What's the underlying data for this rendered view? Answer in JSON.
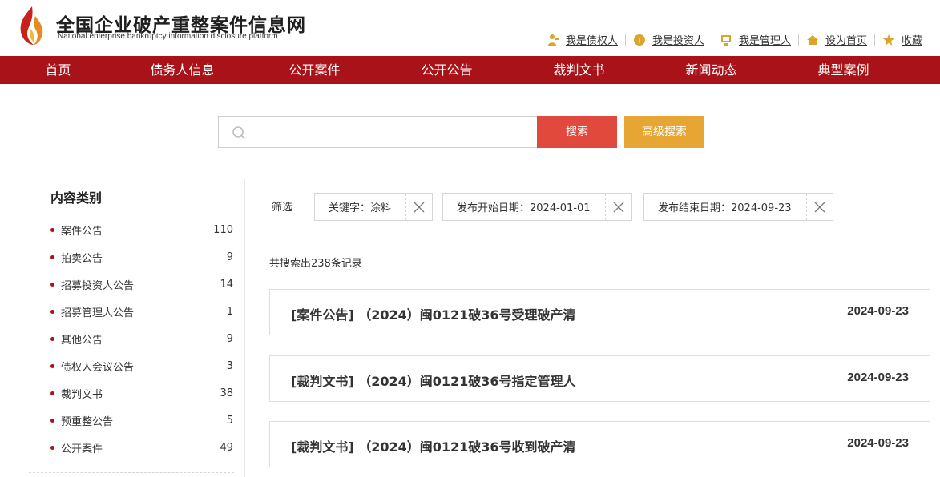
{
  "header": {
    "title": "全国企业破产重整案件信息网",
    "subtitle": "National enterprise bankruptcy  information disclosure platform",
    "toplinks": [
      {
        "label": "我是债权人",
        "icon": "creditor-icon"
      },
      {
        "label": "我是投资人",
        "icon": "investor-icon"
      },
      {
        "label": "我是管理人",
        "icon": "manager-icon"
      },
      {
        "label": "设为首页",
        "icon": "home-icon"
      },
      {
        "label": "收藏",
        "icon": "star-icon"
      }
    ]
  },
  "nav": {
    "items": [
      "首页",
      "债务人信息",
      "公开案件",
      "公开公告",
      "裁判文书",
      "新闻动态",
      "典型案例"
    ]
  },
  "search": {
    "value": "",
    "placeholder": "",
    "search_label": "搜索",
    "advanced_label": "高级搜索"
  },
  "sidebar": {
    "title": "内容类别",
    "items": [
      {
        "label": "案件公告",
        "count": "110"
      },
      {
        "label": "拍卖公告",
        "count": "9"
      },
      {
        "label": "招募投资人公告",
        "count": "14"
      },
      {
        "label": "招募管理人公告",
        "count": "1"
      },
      {
        "label": "其他公告",
        "count": "9"
      },
      {
        "label": "债权人会议公告",
        "count": "3"
      },
      {
        "label": "裁判文书",
        "count": "38"
      },
      {
        "label": "预重整公告",
        "count": "5"
      },
      {
        "label": "公开案件",
        "count": "49"
      }
    ]
  },
  "filters": {
    "label": "筛选",
    "chips": [
      {
        "text": "关键字：涂料"
      },
      {
        "text": "发布开始日期：2024-01-01"
      },
      {
        "text": "发布结束日期：2024-09-23"
      }
    ]
  },
  "results": {
    "summary": "共搜索出238条记录",
    "items": [
      {
        "title": "[案件公告] （2024）闽0121破36号受理破产清",
        "date": "2024-09-23"
      },
      {
        "title": "[裁判文书] （2024）闽0121破36号指定管理人",
        "date": "2024-09-23"
      },
      {
        "title": "[裁判文书] （2024）闽0121破36号收到破产清",
        "date": "2024-09-23"
      }
    ]
  },
  "colors": {
    "brand_red": "#a81218",
    "search_button": "#e0493c",
    "advanced_button": "#e7a534",
    "icon_gold": "#d9a52a"
  }
}
